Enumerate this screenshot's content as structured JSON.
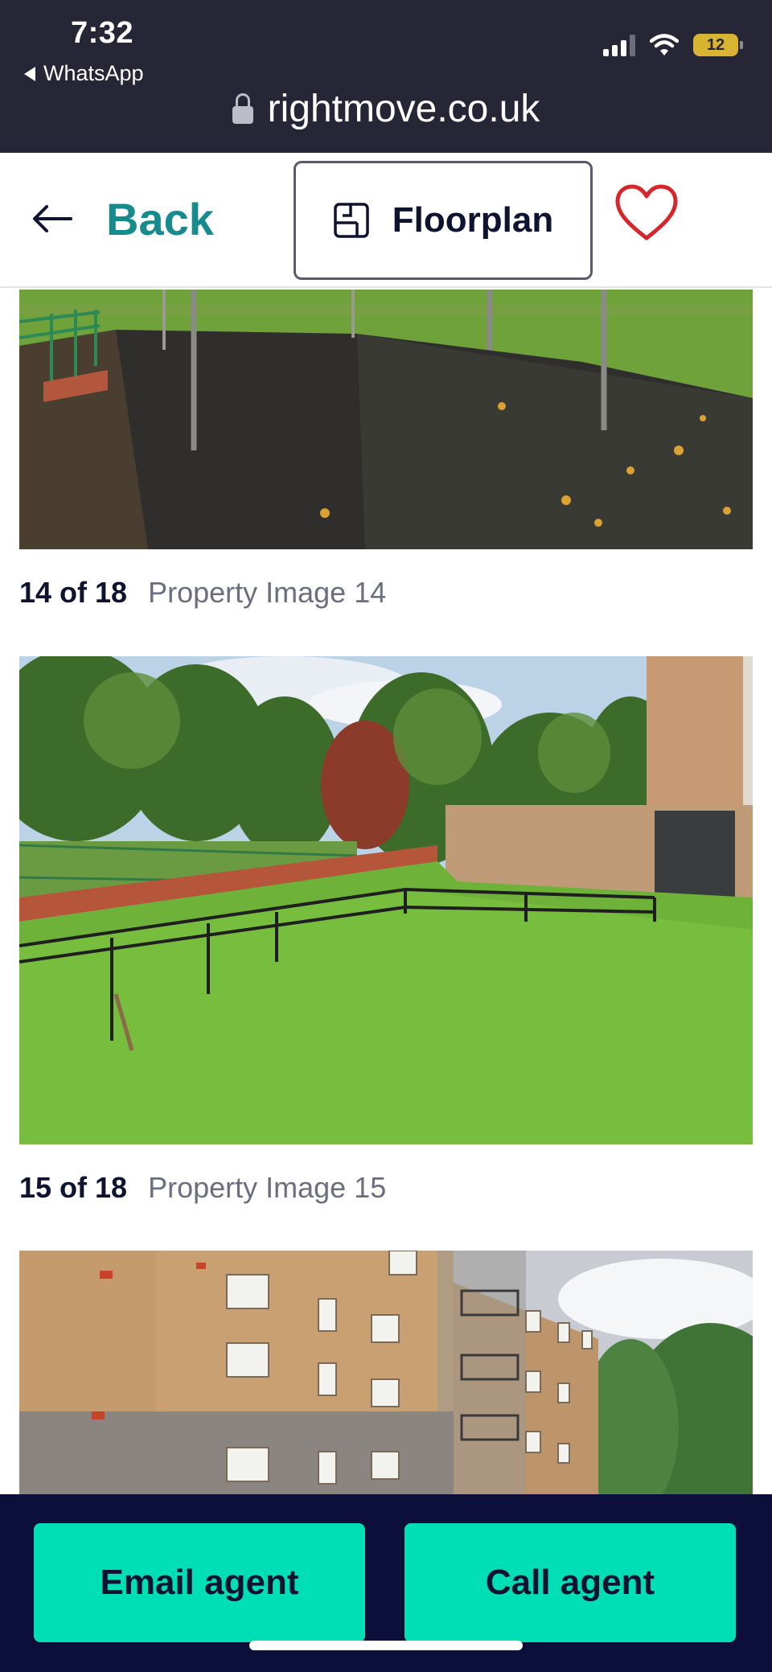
{
  "status_bar": {
    "time": "7:32",
    "back_app": "WhatsApp",
    "battery": "12",
    "url": "rightmove.co.uk"
  },
  "header": {
    "back_label": "Back",
    "floorplan_label": "Floorplan"
  },
  "gallery": {
    "items": [
      {
        "count": "14 of 18",
        "title": "Property Image 14"
      },
      {
        "count": "15 of 18",
        "title": "Property Image 15"
      }
    ]
  },
  "actions": {
    "email_label": "Email agent",
    "call_label": "Call agent"
  },
  "colors": {
    "accent_teal": "#178a8e",
    "cta_green": "#00deb6",
    "cta_bar": "#0c0f3a",
    "status_bar": "#262637",
    "favourite": "#d6262b"
  }
}
